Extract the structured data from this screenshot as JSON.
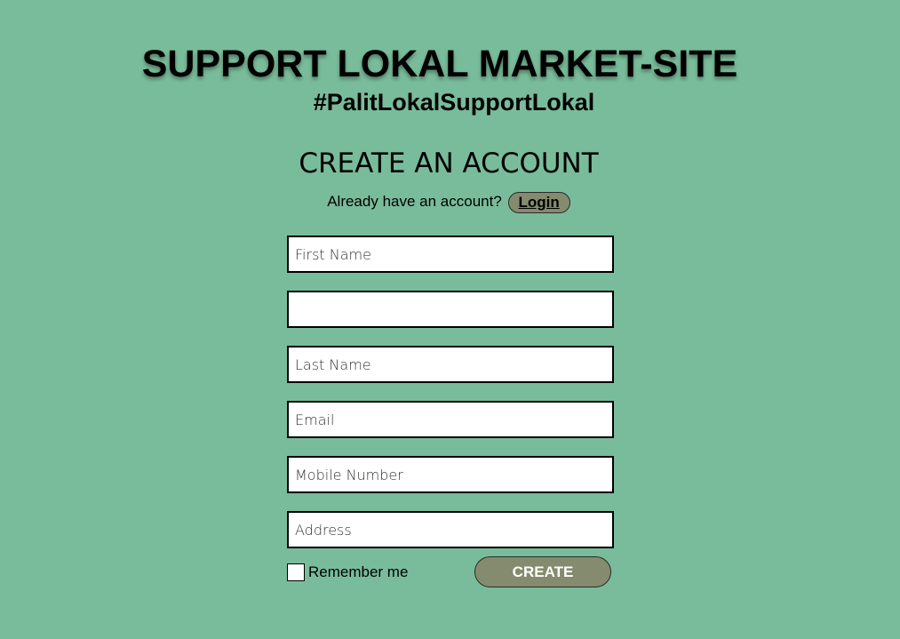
{
  "colors": {
    "background": "#79bc9b",
    "button": "#848b6e",
    "field_bg": "#ffffff",
    "button_text": "#ffffff"
  },
  "header": {
    "title": "SUPPORT LOKAL MARKET-SITE",
    "hashtag": "#PalitLokalSupportLokal"
  },
  "form": {
    "title": "CREATE AN ACCOUNT",
    "have_account_text": "Already have an account?",
    "login_label": "Login",
    "fields": {
      "first_name": {
        "placeholder": "First Name",
        "value": ""
      },
      "middle_name": {
        "placeholder": "",
        "value": ""
      },
      "last_name": {
        "placeholder": "Last Name",
        "value": ""
      },
      "email": {
        "placeholder": "Email",
        "value": ""
      },
      "mobile": {
        "placeholder": "Mobile Number",
        "value": ""
      },
      "address": {
        "placeholder": "Address",
        "value": ""
      }
    },
    "remember_label": "Remember me",
    "create_label": "CREATE"
  }
}
